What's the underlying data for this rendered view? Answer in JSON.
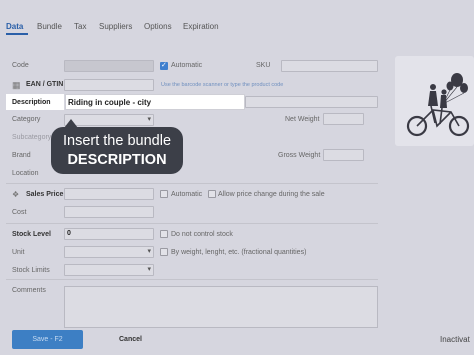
{
  "tabs": [
    {
      "label": "Data"
    },
    {
      "label": "Bundle"
    },
    {
      "label": "Tax"
    },
    {
      "label": "Suppliers"
    },
    {
      "label": "Options"
    },
    {
      "label": "Expiration"
    }
  ],
  "form": {
    "code_label": "Code",
    "automatic_label": "Automatic",
    "automatic_checked": true,
    "sku_label": "SKU",
    "ean_label": "EAN / GTIN",
    "barcode_hint": "Use the barcode scanner or type the product code",
    "description_label": "Description",
    "description_value": "Riding in couple - city",
    "category_label": "Category",
    "net_weight_label": "Net Weight",
    "subcategory_label": "Subcategory",
    "brand_label": "Brand",
    "gross_weight_label": "Gross Weight",
    "location_label": "Location",
    "sales_price_label": "Sales Price",
    "price_automatic_label": "Automatic",
    "allow_price_change_label": "Allow price change during the sale",
    "cost_label": "Cost",
    "stock_level_label": "Stock Level",
    "stock_level_value": "0",
    "do_not_control_label": "Do not control stock",
    "unit_label": "Unit",
    "fractional_label": "By weight, lenght, etc. (fractional quantities)",
    "stock_limits_label": "Stock Limits",
    "comments_label": "Comments"
  },
  "callout": {
    "line1": "Insert the bundle",
    "line2": "DESCRIPTION"
  },
  "footer": {
    "save_label": "Save - F2",
    "cancel_label": "Cancel",
    "inactive_label": "Inactivat"
  },
  "colors": {
    "accent": "#2a5fa8",
    "callout_bg": "#3c3f48",
    "overlay": "#d6d6df"
  }
}
